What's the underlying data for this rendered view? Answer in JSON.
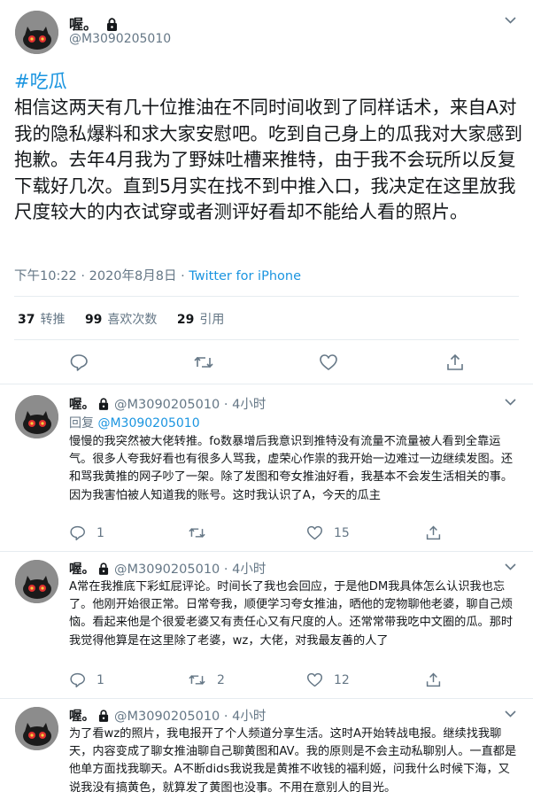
{
  "main_tweet": {
    "display_name": "喔。",
    "handle": "@M3090205010",
    "hashtag": "#吃瓜",
    "text": "相信这两天有几十位推油在不同时间收到了同样话术，来自A对我的隐私爆料和求大家安慰吧。吃到自己身上的瓜我对大家感到抱歉。去年4月我为了野妹吐槽来推特，由于我不会玩所以反复下载好几次。直到5月实在找不到中推入口，我决定在这里放我尺度较大的内衣试穿或者测评好看却不能给人看的照片。",
    "timestamp": "下午10:22 · 2020年8月8日 · ",
    "source": "Twitter for iPhone",
    "stats": {
      "retweets_count": "37",
      "retweets_label": "转推",
      "likes_count": "99",
      "likes_label": "喜欢次数",
      "quotes_count": "29",
      "quotes_label": "引用"
    }
  },
  "replies": [
    {
      "display_name": "喔。",
      "handle_time": "@M3090205010 · 4小时",
      "reply_prefix": "回复 ",
      "reply_to": "@M3090205010",
      "text": "慢慢的我突然被大佬转推。fo数暴增后我意识到推特没有流量不流量被人看到全靠运气。很多人夸我好看也有很多人骂我，虚荣心作祟的我开始一边难过一边继续发图。还和骂我黄推的网子吵了一架。除了发图和夸女推油好看，我基本不会发生活相关的事。因为我害怕被人知道我的账号。这时我认识了A，今天的瓜主",
      "replies": "1",
      "retweets": "",
      "likes": "15"
    },
    {
      "display_name": "喔。",
      "handle_time": "@M3090205010 · 4小时",
      "text": "A常在我推底下彩虹屁评论。时间长了我也会回应，于是他DM我具体怎么认识我也忘了。他刚开始很正常。日常夸我，顺便学习夸女推油，晒他的宠物聊他老婆，聊自己烦恼。看起来他是个很爱老婆又有责任心又有尺度的人。还常常带我吃中文圈的瓜。那时我觉得他算是在这里除了老婆，wz，大佬，对我最友善的人了",
      "replies": "1",
      "retweets": "2",
      "likes": "12"
    },
    {
      "display_name": "喔。",
      "handle_time": "@M3090205010 · 4小时",
      "text": "为了看wz的照片，我电报开了个人频道分享生活。这时A开始转战电报。继续找我聊天，内容变成了聊女推油聊自己聊黄图和AV。我的原则是不会主动私聊别人。一直都是他单方面找我聊天。A不断dids我说我是黄推不收钱的福利姬，问我什么时候下海，又说我没有搞黄色，就算发了黄图也没事。不用在意别人的目光。"
    }
  ],
  "colors": {
    "accent": "#1b95e0",
    "secondary_text": "#657786",
    "divider": "#e6ecf0"
  },
  "icons": [
    "lock-icon",
    "chevron-down-icon",
    "reply-icon",
    "retweet-icon",
    "like-icon",
    "share-icon"
  ]
}
